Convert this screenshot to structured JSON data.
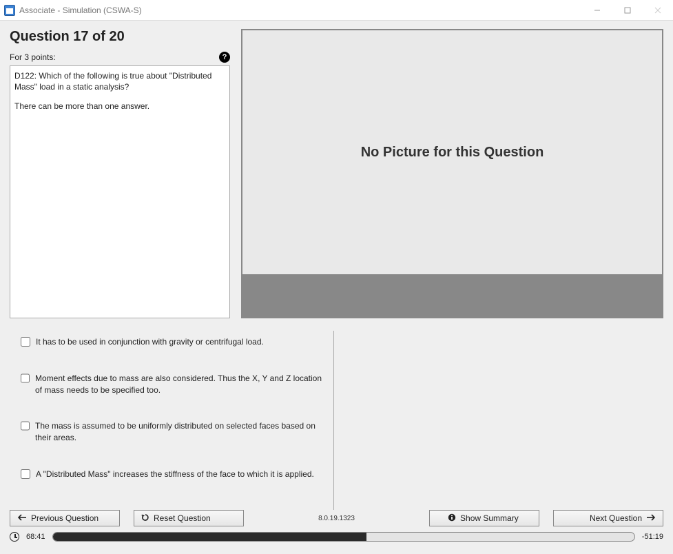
{
  "window": {
    "title": "Associate - Simulation (CSWA-S)"
  },
  "question": {
    "header": "Question 17 of 20",
    "points_label": "For 3 points:",
    "body_line1": "D122: Which of the following is true about \"Distributed Mass\" load in a static analysis?",
    "body_line2": "There can be more than one answer."
  },
  "picture": {
    "placeholder": "No Picture for this Question"
  },
  "answers": [
    {
      "text": "It has to be used in conjunction with gravity or centrifugal load."
    },
    {
      "text": "Moment effects due to mass are also considered. Thus the X, Y and Z location of mass needs to be specified too."
    },
    {
      "text": "The mass is assumed to be uniformly distributed on selected faces based on their areas."
    },
    {
      "text": "A \"Distributed Mass\" increases the stiffness of the face to which it is applied."
    }
  ],
  "buttons": {
    "previous": "Previous Question",
    "reset": "Reset Question",
    "summary": "Show Summary",
    "next": "Next Question"
  },
  "version": "8.0.19.1323",
  "timer": {
    "elapsed": "68:41",
    "remaining": "-51:19",
    "progress_percent": 54
  }
}
